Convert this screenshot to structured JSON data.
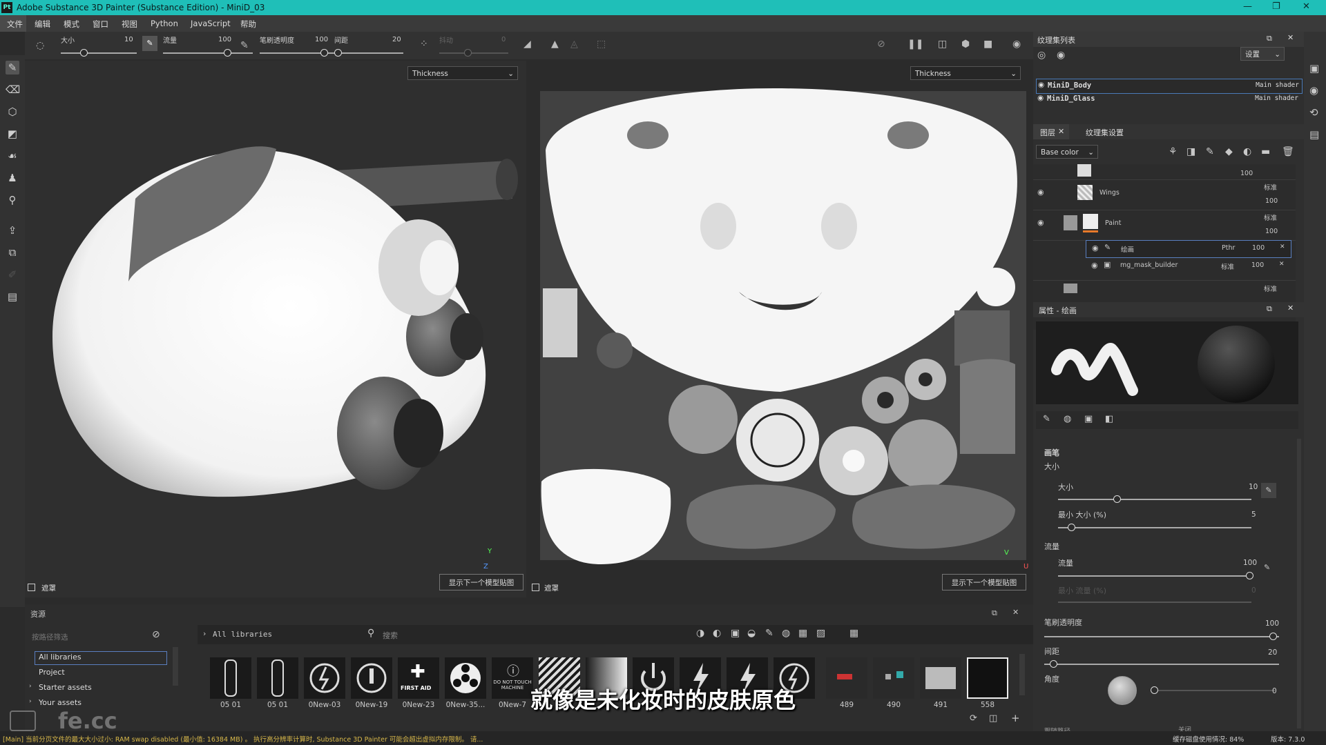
{
  "title_bar": {
    "app_icon": "Pt",
    "title": "Adobe Substance 3D Painter (Substance Edition) - MiniD_03"
  },
  "menu": [
    "文件",
    "编辑",
    "模式",
    "窗口",
    "视图",
    "Python",
    "JavaScript",
    "帮助"
  ],
  "toolbar": {
    "size_label": "大小",
    "size_value": "10",
    "flow_label": "流量",
    "flow_value": "100",
    "opacity_label": "笔刷透明度",
    "opacity_value": "100",
    "spacing_label": "间距",
    "spacing_value": "20",
    "jitter_label": "抖动",
    "jitter_value": "0"
  },
  "viewport3d": {
    "channel": "Thickness",
    "mask_label": "遮罩",
    "next_button": "显示下一个模型贴图",
    "axis_y": "Y",
    "axis_z": "Z"
  },
  "viewport2d": {
    "channel": "Thickness",
    "mask_label": "遮罩",
    "next_button": "显示下一个模型贴图",
    "axis_y": "V",
    "axis_z": "U"
  },
  "texture_sets": {
    "title": "纹理集列表",
    "settings": "设置",
    "items": [
      {
        "name": "MiniD_Body",
        "shader": "Main shader"
      },
      {
        "name": "MiniD_Glass",
        "shader": "Main shader"
      }
    ]
  },
  "layers": {
    "tab_layers": "图层",
    "tab_settings": "纹理集设置",
    "channel": "Base color",
    "rows": [
      {
        "name": "",
        "blend": "",
        "opacity": "100"
      },
      {
        "name": "Wings",
        "blend": "标准",
        "opacity": "100"
      },
      {
        "name": "Paint",
        "blend": "标准",
        "opacity": "100"
      }
    ],
    "effects": [
      {
        "name": "绘画",
        "blend": "Pthr",
        "opacity": "100"
      },
      {
        "name": "mg_mask_builder",
        "blend": "标准",
        "opacity": "100"
      }
    ],
    "last_blend": "标准"
  },
  "properties": {
    "title": "属性 - 绘画",
    "brush_section": "画笔",
    "size_section": "大小",
    "size_label": "大小",
    "size_value": "10",
    "min_size_label": "最小 大小 (%)",
    "min_size_value": "5",
    "flow_section": "流量",
    "flow_label": "流量",
    "flow_value": "100",
    "min_flow_label": "最小 流量 (%)",
    "min_flow_value": "0",
    "opacity_label": "笔刷透明度",
    "opacity_value": "100",
    "spacing_label": "间距",
    "spacing_value": "20",
    "angle_label": "角度",
    "angle_value": "0",
    "bottom_label": "跟随路径",
    "bottom_value": "关闭"
  },
  "assets": {
    "title": "资源",
    "filter_placeholder": "按路径筛选",
    "breadcrumb": "All libraries",
    "search_placeholder": "搜索",
    "libraries": [
      "All libraries",
      "Project",
      "Starter assets",
      "Your assets"
    ],
    "thumbnails": [
      "05 01",
      "05 01",
      "0New-03",
      "0New-19",
      "0New-23",
      "0New-35...",
      "0New-7",
      "",
      "",
      "",
      "",
      "",
      "",
      "489",
      "490",
      "491",
      "558"
    ],
    "thumb_texts": [
      "",
      "",
      "",
      "",
      "FIRST AID",
      "",
      "DO NOT TOUCH MACHINE",
      "",
      "",
      "",
      "",
      "",
      "",
      "",
      "",
      "",
      ""
    ]
  },
  "subtitle": "就像是未化妆时的皮肤原色",
  "watermark": "fe.cc",
  "status": {
    "message": "[Main] 当前分页文件的最大大小过小: RAM swap disabled (最小值: 16384 MB) 。 执行高分辨率计算时, Substance 3D Painter 可能会超出虚拟内存限制。 请...",
    "disk": "缓存磁盘使用情况: 84%",
    "version": "版本: 7.3.0"
  }
}
